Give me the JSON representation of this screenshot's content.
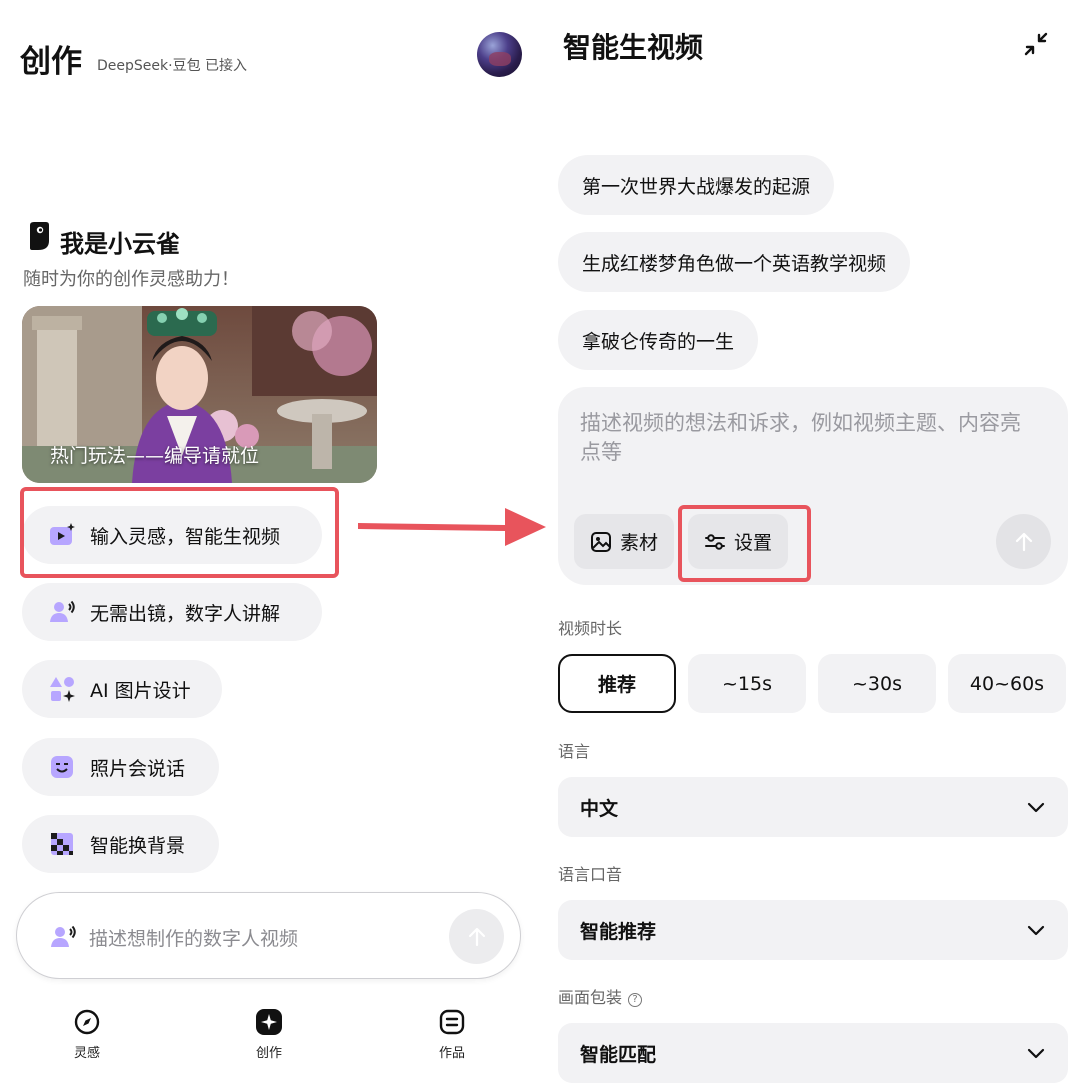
{
  "left": {
    "header": {
      "title": "创作",
      "subtitle": "DeepSeek·豆包 已接入"
    },
    "intro": {
      "title": "我是小云雀",
      "subtitle": "随时为你的创作灵感助力！"
    },
    "hero": {
      "caption": "热门玩法——编导请就位"
    },
    "features": [
      {
        "label": "输入灵感，智能生视频",
        "icon": "video-sparkle-icon"
      },
      {
        "label": "无需出镜，数字人讲解",
        "icon": "digital-human-icon"
      },
      {
        "label": "AI 图片设计",
        "icon": "shapes-sparkle-icon"
      },
      {
        "label": "照片会说话",
        "icon": "talking-face-icon"
      },
      {
        "label": "智能换背景",
        "icon": "background-swap-icon"
      }
    ],
    "prompt": {
      "placeholder": "描述想制作的数字人视频"
    },
    "tabs": [
      {
        "label": "灵感",
        "icon": "compass-icon"
      },
      {
        "label": "创作",
        "icon": "sparkle-icon"
      },
      {
        "label": "作品",
        "icon": "works-icon"
      }
    ]
  },
  "right": {
    "title": "智能生视频",
    "suggestions": [
      "第一次世界大战爆发的起源",
      "生成红楼梦角色做一个英语教学视频",
      "拿破仑传奇的一生"
    ],
    "compose": {
      "placeholder": "描述视频的想法和诉求，例如视频主题、内容亮点等",
      "material_label": "素材",
      "settings_label": "设置"
    },
    "duration": {
      "label": "视频时长",
      "options": [
        "推荐",
        "~15s",
        "~30s",
        "40~60s"
      ],
      "selected": "推荐"
    },
    "language": {
      "label": "语言",
      "value": "中文"
    },
    "accent": {
      "label": "语言口音",
      "value": "智能推荐"
    },
    "packaging": {
      "label": "画面包装",
      "value": "智能匹配"
    }
  },
  "colors": {
    "highlight": "#e8545c",
    "pill_bg": "#f2f2f4",
    "accent_purple": "#7a5cff"
  }
}
